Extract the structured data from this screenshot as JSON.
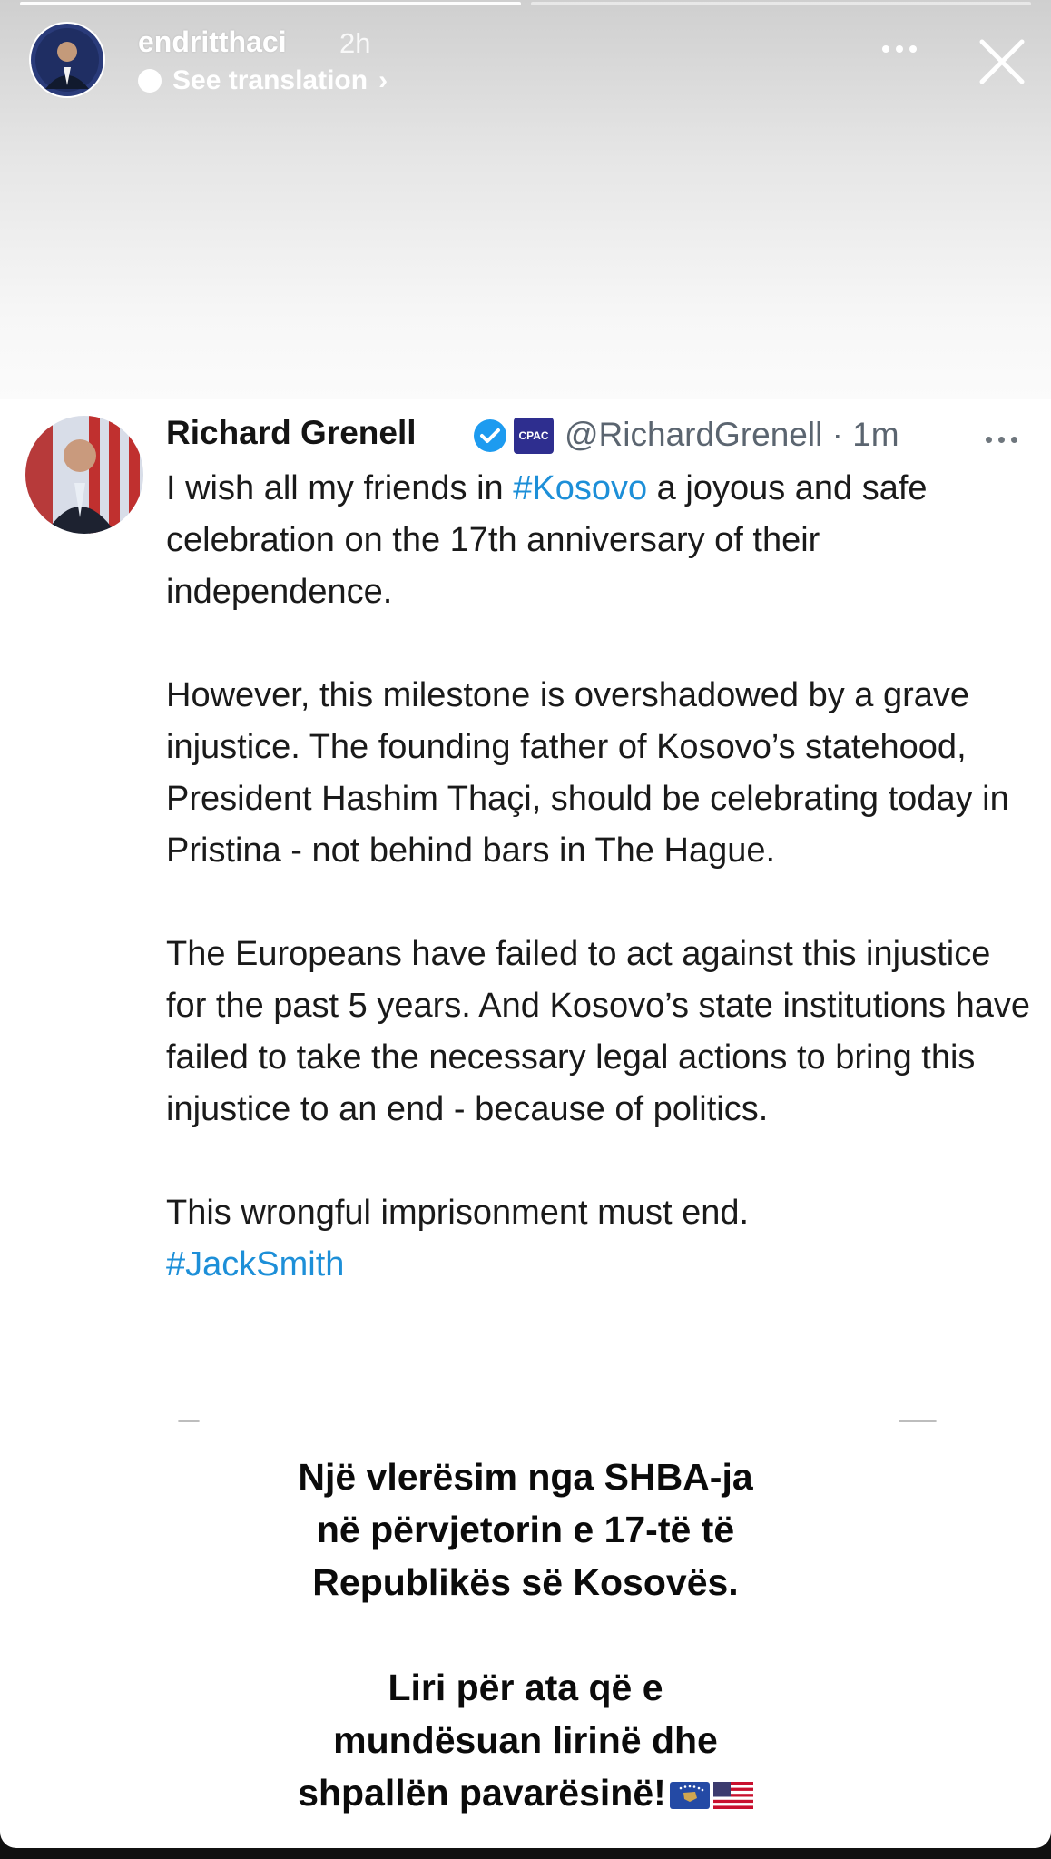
{
  "story": {
    "username": "endritthaci",
    "time": "2h",
    "see_translation": "See translation"
  },
  "tweet": {
    "author_name": "Richard Grenell",
    "org_badge": "CPAC",
    "handle_time": "@RichardGrenell · 1m",
    "paragraphs": {
      "p1_before": "I wish all my friends in ",
      "p1_hashtag": "#Kosovo",
      "p1_after": " a joyous and safe celebration on the 17th anniversary of their independence.",
      "p2": "However, this milestone is overshadowed by a grave injustice. The founding father of Kosovo’s statehood, President Hashim Thaçi, should be celebrating today in Pristina - not behind bars in The Hague.",
      "p3": "The Europeans have failed to act against this injustice for the past 5 years. And Kosovo’s state institutions have failed to take the necessary legal actions to bring this injustice to an end - because of politics.",
      "p4": "This wrongful imprisonment must end.",
      "p4_hashtag": "#JackSmith"
    }
  },
  "caption": {
    "line1": "Një vlerësim nga SHBA-ja",
    "line2": "në përvjetorin e 17-të të",
    "line3": "Republikës së Kosovës.",
    "line4": "Liri për ata që e",
    "line5": "mundësuan lirinë dhe",
    "line6": "shpallën pavarësinë!"
  },
  "colors": {
    "hashtag": "#1d8fd8",
    "verified": "#1d9bf0"
  }
}
